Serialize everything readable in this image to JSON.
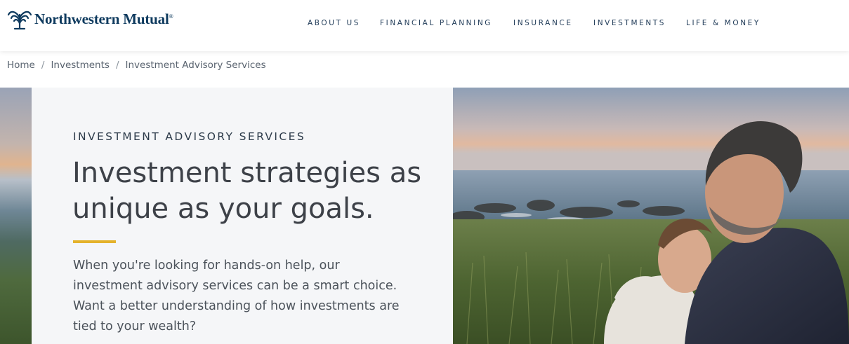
{
  "brand": {
    "name": "Northwestern Mutual",
    "registered": "®",
    "color": "#0e3a5e"
  },
  "nav": {
    "items": [
      {
        "label": "ABOUT US"
      },
      {
        "label": "FINANCIAL PLANNING"
      },
      {
        "label": "INSURANCE"
      },
      {
        "label": "INVESTMENTS"
      },
      {
        "label": "LIFE & MONEY"
      }
    ]
  },
  "breadcrumb": {
    "items": [
      {
        "label": "Home"
      },
      {
        "label": "Investments"
      }
    ],
    "separator": "/",
    "current": "Investment Advisory Services"
  },
  "hero": {
    "eyebrow": "INVESTMENT ADVISORY SERVICES",
    "headline": "Investment strategies as unique as your goals.",
    "body": "When you're looking for hands-on help, our investment advisory services can be a smart choice. Want a better understanding of how investments are tied to your wealth?",
    "accent_color": "#e4b22b",
    "image_icon": "couple-by-sea-photo"
  }
}
